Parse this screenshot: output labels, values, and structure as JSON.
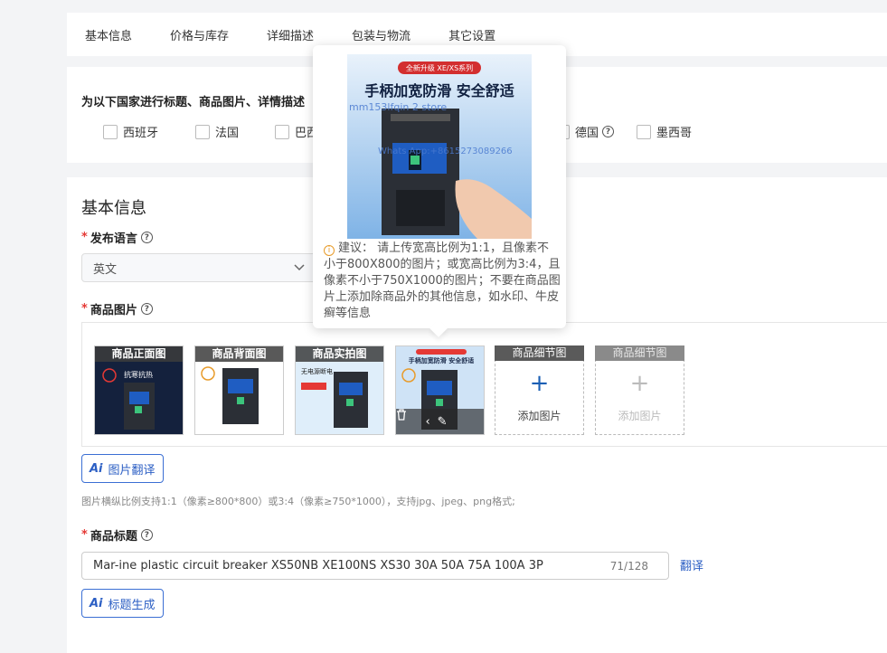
{
  "tabs": [
    "基本信息",
    "价格与库存",
    "详细描述",
    "包装与物流",
    "其它设置"
  ],
  "country_section": {
    "title": "为以下国家进行标题、商品图片、详情描述",
    "countries": [
      "西班牙",
      "法国",
      "巴西",
      "德国",
      "墨西哥"
    ]
  },
  "basic_info": {
    "section_title": "基本信息",
    "language_label": "发布语言",
    "language_value": "英文",
    "images_label": "商品图片",
    "image_slots": [
      {
        "caption": "商品正面图",
        "headline": "抗寒抗热",
        "kind": "dark"
      },
      {
        "caption": "商品背面图",
        "headline": "",
        "kind": "white"
      },
      {
        "caption": "商品实拍图",
        "headline": "无电源断电",
        "kind": "light"
      },
      {
        "caption": "",
        "headline": "手柄加宽防滑 安全舒适",
        "kind": "blue"
      }
    ],
    "add_slots": [
      {
        "caption": "商品细节图",
        "label": "添加图片",
        "enabled": true
      },
      {
        "caption": "商品细节图",
        "label": "添加图片",
        "enabled": false
      }
    ],
    "image_translate_button": "图片翻译",
    "image_note": "图片横纵比例支持1:1（像素≥800*800）或3:4（像素≥750*1000），支持jpg、jpeg、png格式;",
    "title_label": "商品标题",
    "title_value": "Mar-ine plastic circuit breaker XS50NB XE100NS XS30 30A 50A 75A 100A 3P",
    "title_counter": "71/128",
    "translate_link": "翻译",
    "title_generate_button": "标题生成"
  },
  "popover": {
    "image_banner": "全新升级 XE/XS系列",
    "image_headline": "手柄加宽防滑 安全舒适",
    "image_watermark_1": "mm153lfqin 2 store",
    "image_watermark_2": "Whats App:+8615273089266",
    "advice": "建议： 请上传宽高比例为1:1，且像素不小于800X800的图片；或宽高比例为3:4，且像素不小于750X1000的图片；不要在商品图片上添加除商品外的其他信息，如水印、牛皮癣等信息"
  },
  "colors": {
    "accent": "#2c5fc4",
    "required": "#e53935",
    "warning": "#e89b2a"
  }
}
